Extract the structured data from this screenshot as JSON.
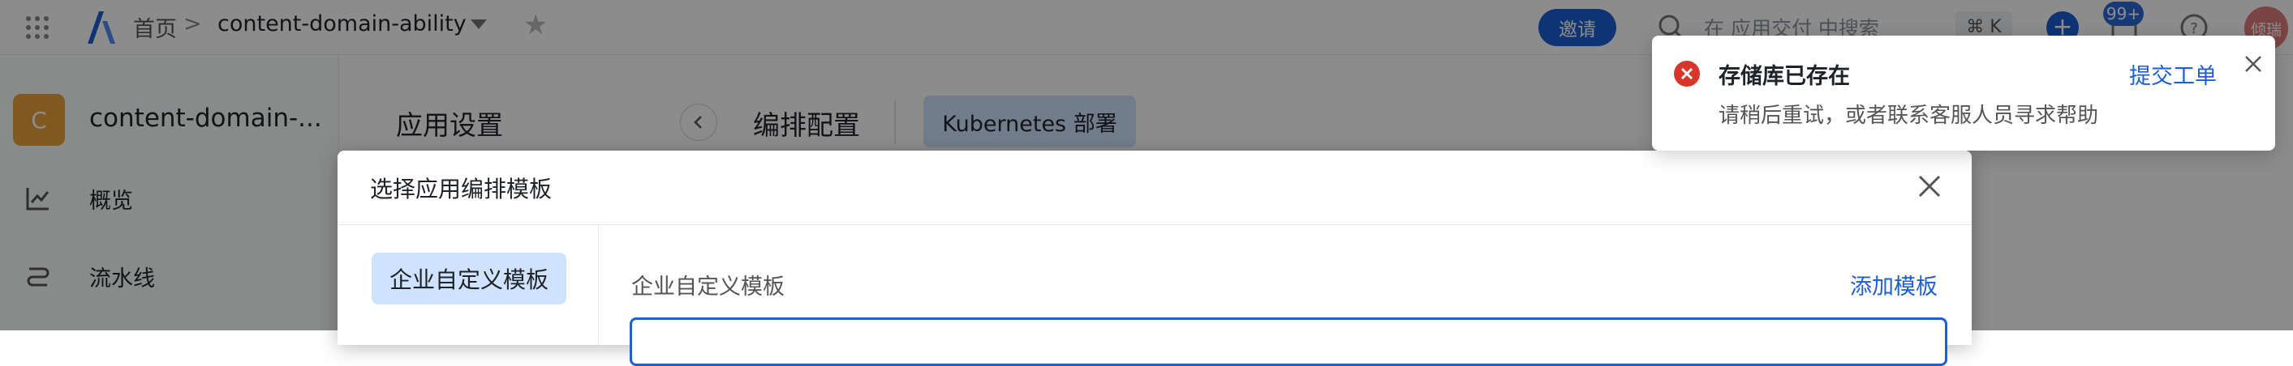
{
  "topbar": {
    "breadcrumb_home": "首页",
    "breadcrumb_sep": ">",
    "project": "content-domain-ability",
    "invite_label": "邀请",
    "search_placeholder": "在 应用交付 中搜索",
    "shortcut": "⌘ K",
    "plus": "+",
    "notif_count": "99+",
    "avatar_text": "倾瑞"
  },
  "sidebar": {
    "project_initial": "C",
    "project_name": "content-domain-...",
    "items": [
      {
        "label": "概览",
        "icon": "line-chart-icon"
      },
      {
        "label": "流水线",
        "icon": "pipeline-icon"
      }
    ]
  },
  "main": {
    "page_title": "应用设置",
    "section_title": "编排配置",
    "tag": "Kubernetes 部署"
  },
  "modal": {
    "title": "选择应用编排模板",
    "tab": "企业自定义模板",
    "section_label": "企业自定义模板",
    "add_label": "添加模板"
  },
  "toast": {
    "title": "存储库已存在",
    "desc": "请稍后重试，或者联系客服人员寻求帮助",
    "link": "提交工单"
  },
  "colors": {
    "accent": "#1b5fd3",
    "error": "#d9362b",
    "selected_bg": "#cfe3ff",
    "tile": "#e8a33a"
  }
}
